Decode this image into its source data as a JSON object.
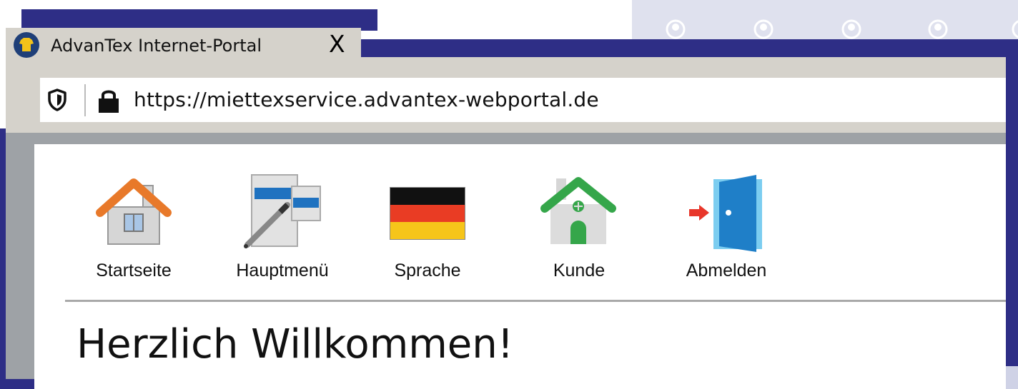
{
  "window": {
    "tab_title": "AdvanTex Internet-Portal",
    "tab_close": "X",
    "favicon": "tshirt-icon"
  },
  "address_bar": {
    "url": "https://miettexservice.advantex-webportal.de",
    "shield": "shield-icon",
    "lock": "lock-icon"
  },
  "toolbar": {
    "items": [
      {
        "label": "Startseite",
        "icon": "house-icon"
      },
      {
        "label": "Hauptmenü",
        "icon": "menu-pen-icon"
      },
      {
        "label": "Sprache",
        "icon": "german-flag-icon"
      },
      {
        "label": "Kunde",
        "icon": "customer-house-icon"
      },
      {
        "label": "Abmelden",
        "icon": "logout-door-icon"
      }
    ]
  },
  "main": {
    "heading": "Herzlich Willkommen!"
  },
  "colors": {
    "frame_navy": "#2e2e86",
    "chrome_gray": "#d5d2cb",
    "accent_blue": "#1f72c0",
    "pattern_bg": "#dfe1ee"
  }
}
